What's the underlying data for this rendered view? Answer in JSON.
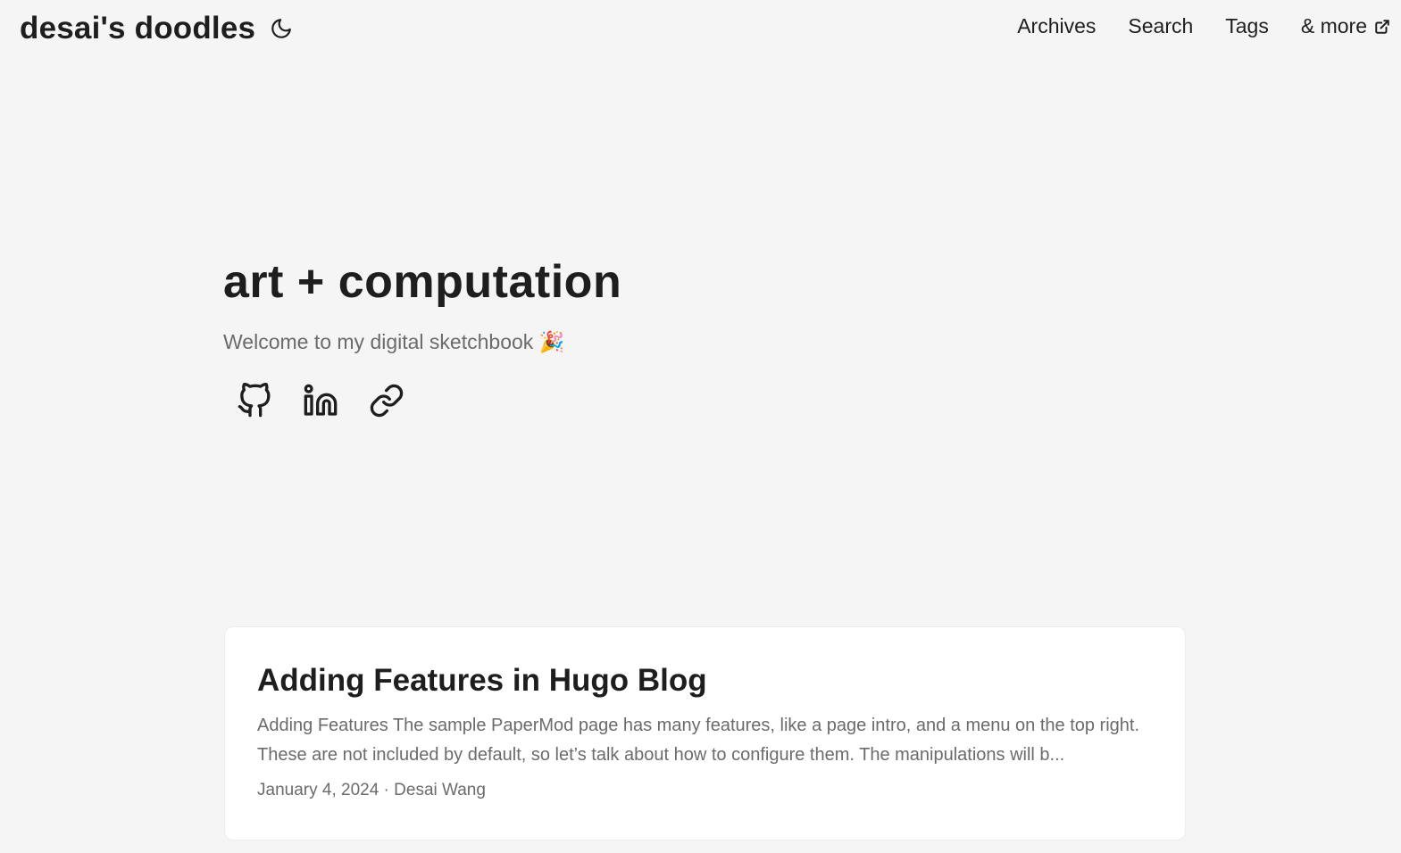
{
  "header": {
    "logo": "desai's doodles",
    "theme_toggle_icon": "moon-icon",
    "menu": [
      {
        "label": "Archives"
      },
      {
        "label": "Search"
      },
      {
        "label": "Tags"
      },
      {
        "label": "& more",
        "icon": "external-link-icon"
      }
    ]
  },
  "hero": {
    "title": "art + computation",
    "subtitle": "Welcome to my digital sketchbook 🎉",
    "social": [
      {
        "icon": "github-icon"
      },
      {
        "icon": "linkedin-icon"
      },
      {
        "icon": "link-icon"
      }
    ]
  },
  "posts": [
    {
      "title": "Adding Features in Hugo Blog",
      "summary": "Adding Features The sample PaperMod page has many features, like a page intro, and a menu on the top right. These are not included by default, so let’s talk about how to configure them. The manipulations will b...",
      "meta": "January 4, 2024 · Desai Wang"
    }
  ]
}
